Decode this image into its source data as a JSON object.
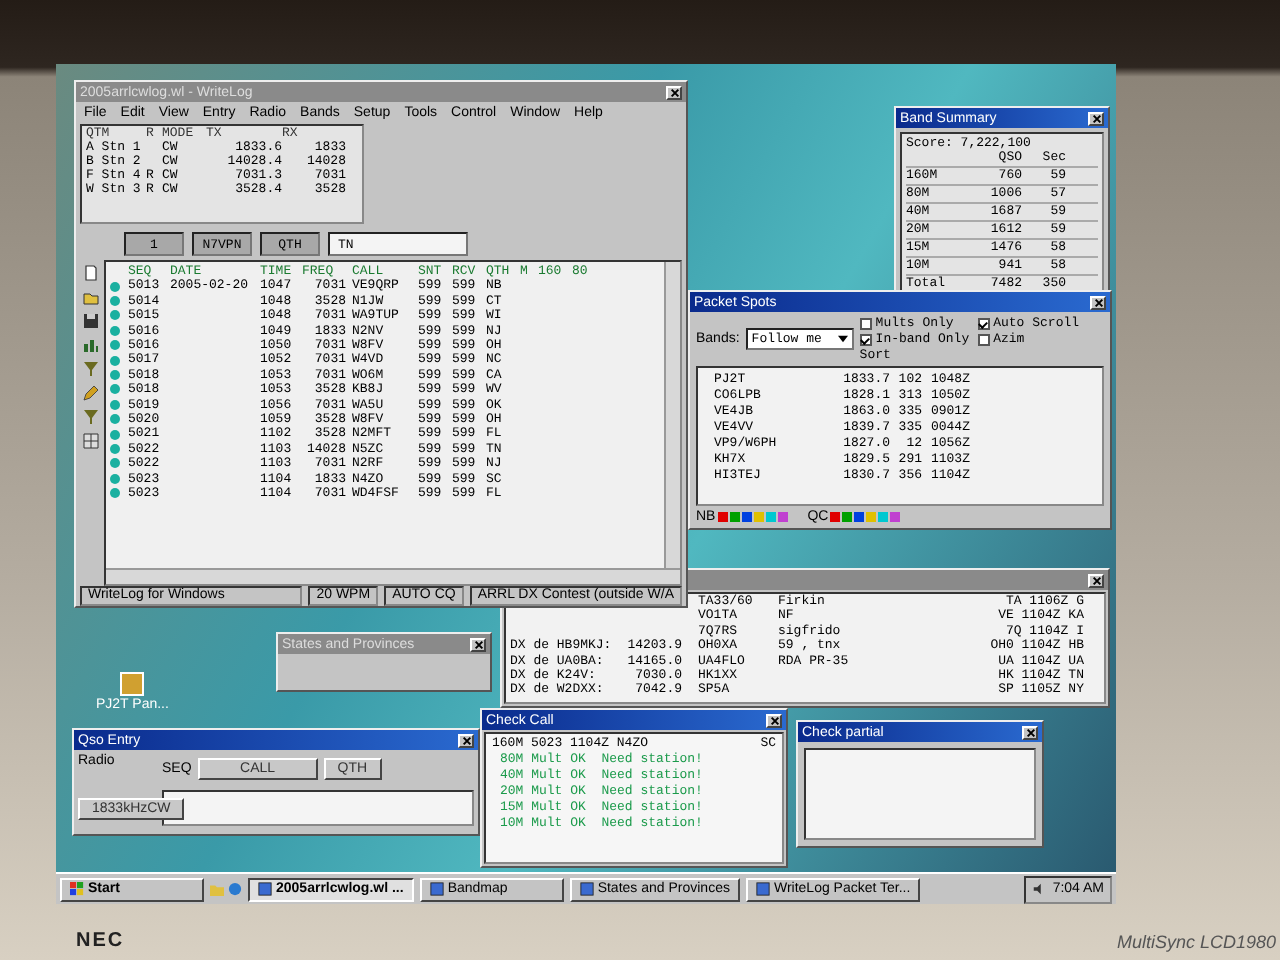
{
  "monitor": {
    "brand": "NEC",
    "model": "MultiSync LCD1980"
  },
  "desktop": {
    "icons": [
      {
        "label": "PJ2T Pan..."
      }
    ]
  },
  "writelog": {
    "title": "2005arrlcwlog.wl - WriteLog",
    "active": false,
    "menu": [
      "File",
      "Edit",
      "View",
      "Entry",
      "Radio",
      "Bands",
      "Setup",
      "Tools",
      "Control",
      "Window",
      "Help"
    ],
    "radios": {
      "columns": [
        "QTM",
        "R",
        "MODE",
        "TX",
        "RX"
      ],
      "rows": [
        {
          "qtm": "A Stn 1",
          "mode": "CW",
          "tx": "1833.6",
          "rx": "1833"
        },
        {
          "qtm": "B Stn 2",
          "mode": "CW",
          "tx": "14028.4",
          "rx": "14028"
        },
        {
          "qtm": "F Stn 4",
          "r": "R",
          "mode": "CW",
          "tx": "7031.3",
          "rx": "7031"
        },
        {
          "qtm": "W Stn 3",
          "r": "R",
          "mode": "CW",
          "tx": "3528.4",
          "rx": "3528"
        }
      ]
    },
    "entry": [
      "1",
      "N7VPN",
      "QTH",
      "TN"
    ],
    "log": {
      "columns": [
        "SEQ",
        "DATE",
        "TIME",
        "FREQ",
        "CALL",
        "SNT",
        "RCV",
        "QTH",
        "M",
        "160",
        "80"
      ],
      "rows": [
        {
          "seq": "5013",
          "date": "2005-02-20",
          "time": "1047",
          "freq": "7031",
          "call": "VE9QRP",
          "snt": "599",
          "rcv": "599",
          "qth": "NB"
        },
        {
          "seq": "5014",
          "time": "1048",
          "freq": "3528",
          "call": "N1JW",
          "snt": "599",
          "rcv": "599",
          "qth": "CT"
        },
        {
          "seq": "5015",
          "time": "1048",
          "freq": "7031",
          "call": "WA9TUP",
          "snt": "599",
          "rcv": "599",
          "qth": "WI"
        },
        {
          "seq": "5016",
          "time": "1049",
          "freq": "1833",
          "call": "N2NV",
          "snt": "599",
          "rcv": "599",
          "qth": "NJ"
        },
        {
          "seq": "5016",
          "time": "1050",
          "freq": "7031",
          "call": "W8FV",
          "snt": "599",
          "rcv": "599",
          "qth": "OH"
        },
        {
          "seq": "5017",
          "time": "1052",
          "freq": "7031",
          "call": "W4VD",
          "snt": "599",
          "rcv": "599",
          "qth": "NC"
        },
        {
          "seq": "5018",
          "time": "1053",
          "freq": "7031",
          "call": "WO6M",
          "snt": "599",
          "rcv": "599",
          "qth": "CA"
        },
        {
          "seq": "5018",
          "time": "1053",
          "freq": "3528",
          "call": "KB8J",
          "snt": "599",
          "rcv": "599",
          "qth": "WV"
        },
        {
          "seq": "5019",
          "time": "1056",
          "freq": "7031",
          "call": "WA5U",
          "snt": "599",
          "rcv": "599",
          "qth": "OK"
        },
        {
          "seq": "5020",
          "time": "1059",
          "freq": "3528",
          "call": "W8FV",
          "snt": "599",
          "rcv": "599",
          "qth": "OH"
        },
        {
          "seq": "5021",
          "time": "1102",
          "freq": "3528",
          "call": "N2MFT",
          "snt": "599",
          "rcv": "599",
          "qth": "FL"
        },
        {
          "seq": "5022",
          "time": "1103",
          "freq": "14028",
          "call": "N5ZC",
          "snt": "599",
          "rcv": "599",
          "qth": "TN"
        },
        {
          "seq": "5022",
          "time": "1103",
          "freq": "7031",
          "call": "N2RF",
          "snt": "599",
          "rcv": "599",
          "qth": "NJ"
        },
        {
          "seq": "5023",
          "time": "1104",
          "freq": "1833",
          "call": "N4ZO",
          "snt": "599",
          "rcv": "599",
          "qth": "SC"
        },
        {
          "seq": "5023",
          "time": "1104",
          "freq": "7031",
          "call": "WD4FSF",
          "snt": "599",
          "rcv": "599",
          "qth": "FL"
        }
      ]
    },
    "status_bar": [
      "WriteLog for Windows",
      "20 WPM",
      "AUTO CQ",
      "ARRL DX Contest (outside W/A"
    ]
  },
  "band_summary": {
    "title": "Band Summary",
    "active": true,
    "score": "Score: 7,222,100",
    "headers": {
      "qso": "QSO",
      "sec": "Sec"
    },
    "rows": [
      {
        "band": "160M",
        "qso": "760",
        "sec": "59"
      },
      {
        "band": "80M",
        "qso": "1006",
        "sec": "57"
      },
      {
        "band": "40M",
        "qso": "1687",
        "sec": "59"
      },
      {
        "band": "20M",
        "qso": "1612",
        "sec": "59"
      },
      {
        "band": "15M",
        "qso": "1476",
        "sec": "58"
      },
      {
        "band": "10M",
        "qso": "941",
        "sec": "58"
      },
      {
        "band": "Total",
        "qso": "7482",
        "sec": "350"
      }
    ]
  },
  "packet_spots": {
    "title": "Packet Spots",
    "active": true,
    "bands_label": "Bands:",
    "bands_value": "Follow me",
    "options": [
      {
        "kind": "checkbox",
        "label": "Mults Only",
        "checked": false
      },
      {
        "kind": "checkbox",
        "label": "Auto Scroll",
        "checked": true
      },
      {
        "kind": "checkbox",
        "label": "In-band Only",
        "checked": true
      },
      {
        "kind": "checkbox",
        "label": "Azim",
        "checked": false
      },
      {
        "kind": "label",
        "label": "Sort"
      }
    ],
    "spots": [
      [
        "PJ2T",
        "1833.7",
        "102",
        "1048Z"
      ],
      [
        "CO6LPB",
        "1828.1",
        "313",
        "1050Z"
      ],
      [
        "VE4JB",
        "1863.0",
        "335",
        "0901Z"
      ],
      [
        "VE4VV",
        "1839.7",
        "335",
        "0044Z"
      ],
      [
        "VP9/W6PH",
        "1827.0",
        "12",
        "1056Z"
      ],
      [
        "KH7X",
        "1829.5",
        "291",
        "1103Z"
      ],
      [
        "HI3TEJ",
        "1830.7",
        "356",
        "1104Z"
      ]
    ],
    "legend": [
      {
        "label": "NB",
        "swatches": [
          {
            "color": "#e00000"
          },
          {
            "color": "#00a000"
          },
          {
            "color": "#0040e0"
          },
          {
            "color": "#e0c000"
          },
          {
            "color": "#00c8d0"
          },
          {
            "color": "#c040d0"
          }
        ]
      },
      {
        "label": "QC",
        "swatches": [
          {
            "color": "#e00000"
          },
          {
            "color": "#00a000"
          },
          {
            "color": "#0040e0"
          },
          {
            "color": "#e0c000"
          },
          {
            "color": "#00c8d0"
          },
          {
            "color": "#c040d0"
          }
        ]
      }
    ]
  },
  "states_window": {
    "title": "States and Provinces",
    "active": false
  },
  "packet_terminal": {
    "lines": [
      {
        "dx": "TA33/60",
        "comment": "Firkin",
        "tail": "TA 1106Z G"
      },
      {
        "dx": "VO1TA",
        "comment": "NF",
        "tail": "VE 1104Z KA"
      },
      {
        "dx": "7Q7RS",
        "comment": "sigfrido",
        "tail": "7Q 1104Z I"
      },
      {
        "spotter": "DX de HB9MKJ:",
        "freq": "14203.9",
        "dx": "OH0XA",
        "comment": "59 , tnx",
        "tail": "OH0 1104Z HB"
      },
      {
        "spotter": "DX de UA0BA:",
        "freq": "14165.0",
        "dx": "UA4FLO",
        "comment": "RDA PR-35",
        "tail": "UA 1104Z UA"
      },
      {
        "spotter": "DX de K24V:",
        "freq": "7030.0",
        "dx": "HK1XX",
        "tail": "HK 1104Z TN"
      },
      {
        "spotter": "DX de W2DXX:",
        "freq": "7042.9",
        "dx": "SP5A",
        "tail": "SP 1105Z NY"
      }
    ]
  },
  "check_call": {
    "title": "Check Call",
    "active": true,
    "header": "160M 5023 1104Z N4ZO",
    "section": "SC",
    "lines": [
      "80M Mult OK  Need station!",
      "40M Mult OK  Need station!",
      "20M Mult OK  Need station!",
      "15M Mult OK  Need station!",
      "10M Mult OK  Need station!"
    ]
  },
  "check_partial": {
    "title": "Check partial",
    "active": true
  },
  "qso_entry": {
    "title": "Qso Entry",
    "active": true,
    "radio_label": "Radio",
    "seq_label": "SEQ",
    "buttons": [
      "CALL",
      "QTH"
    ],
    "freq_button": "1833kHzCW"
  },
  "taskbar": {
    "start": "Start",
    "tasks": [
      {
        "label": "2005arrlcwlog.wl ...",
        "selected": true
      },
      {
        "label": "Bandmap",
        "selected": false
      },
      {
        "label": "States and Provinces",
        "selected": false
      },
      {
        "label": "WriteLog Packet Ter...",
        "selected": false
      }
    ],
    "time": "7:04 AM"
  }
}
